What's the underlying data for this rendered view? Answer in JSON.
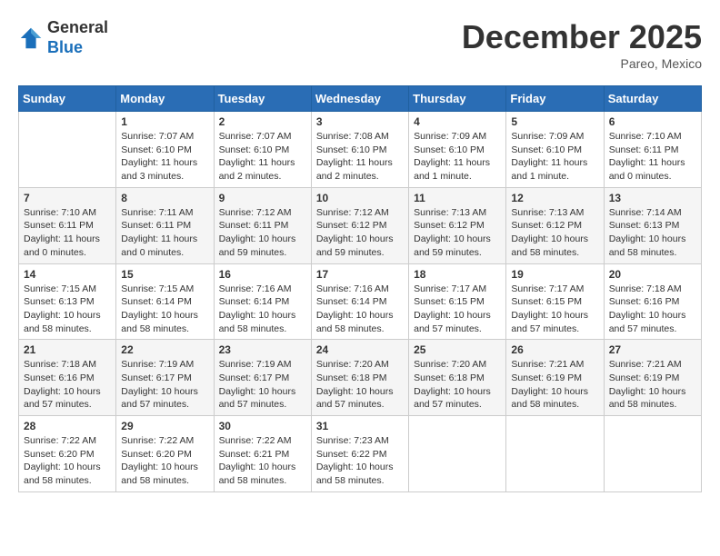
{
  "header": {
    "logo_general": "General",
    "logo_blue": "Blue",
    "month_title": "December 2025",
    "location": "Pareo, Mexico"
  },
  "days_of_week": [
    "Sunday",
    "Monday",
    "Tuesday",
    "Wednesday",
    "Thursday",
    "Friday",
    "Saturday"
  ],
  "weeks": [
    [
      {
        "day": "",
        "info": ""
      },
      {
        "day": "1",
        "info": "Sunrise: 7:07 AM\nSunset: 6:10 PM\nDaylight: 11 hours\nand 3 minutes."
      },
      {
        "day": "2",
        "info": "Sunrise: 7:07 AM\nSunset: 6:10 PM\nDaylight: 11 hours\nand 2 minutes."
      },
      {
        "day": "3",
        "info": "Sunrise: 7:08 AM\nSunset: 6:10 PM\nDaylight: 11 hours\nand 2 minutes."
      },
      {
        "day": "4",
        "info": "Sunrise: 7:09 AM\nSunset: 6:10 PM\nDaylight: 11 hours\nand 1 minute."
      },
      {
        "day": "5",
        "info": "Sunrise: 7:09 AM\nSunset: 6:10 PM\nDaylight: 11 hours\nand 1 minute."
      },
      {
        "day": "6",
        "info": "Sunrise: 7:10 AM\nSunset: 6:11 PM\nDaylight: 11 hours\nand 0 minutes."
      }
    ],
    [
      {
        "day": "7",
        "info": "Sunrise: 7:10 AM\nSunset: 6:11 PM\nDaylight: 11 hours\nand 0 minutes."
      },
      {
        "day": "8",
        "info": "Sunrise: 7:11 AM\nSunset: 6:11 PM\nDaylight: 11 hours\nand 0 minutes."
      },
      {
        "day": "9",
        "info": "Sunrise: 7:12 AM\nSunset: 6:11 PM\nDaylight: 10 hours\nand 59 minutes."
      },
      {
        "day": "10",
        "info": "Sunrise: 7:12 AM\nSunset: 6:12 PM\nDaylight: 10 hours\nand 59 minutes."
      },
      {
        "day": "11",
        "info": "Sunrise: 7:13 AM\nSunset: 6:12 PM\nDaylight: 10 hours\nand 59 minutes."
      },
      {
        "day": "12",
        "info": "Sunrise: 7:13 AM\nSunset: 6:12 PM\nDaylight: 10 hours\nand 58 minutes."
      },
      {
        "day": "13",
        "info": "Sunrise: 7:14 AM\nSunset: 6:13 PM\nDaylight: 10 hours\nand 58 minutes."
      }
    ],
    [
      {
        "day": "14",
        "info": "Sunrise: 7:15 AM\nSunset: 6:13 PM\nDaylight: 10 hours\nand 58 minutes."
      },
      {
        "day": "15",
        "info": "Sunrise: 7:15 AM\nSunset: 6:14 PM\nDaylight: 10 hours\nand 58 minutes."
      },
      {
        "day": "16",
        "info": "Sunrise: 7:16 AM\nSunset: 6:14 PM\nDaylight: 10 hours\nand 58 minutes."
      },
      {
        "day": "17",
        "info": "Sunrise: 7:16 AM\nSunset: 6:14 PM\nDaylight: 10 hours\nand 58 minutes."
      },
      {
        "day": "18",
        "info": "Sunrise: 7:17 AM\nSunset: 6:15 PM\nDaylight: 10 hours\nand 57 minutes."
      },
      {
        "day": "19",
        "info": "Sunrise: 7:17 AM\nSunset: 6:15 PM\nDaylight: 10 hours\nand 57 minutes."
      },
      {
        "day": "20",
        "info": "Sunrise: 7:18 AM\nSunset: 6:16 PM\nDaylight: 10 hours\nand 57 minutes."
      }
    ],
    [
      {
        "day": "21",
        "info": "Sunrise: 7:18 AM\nSunset: 6:16 PM\nDaylight: 10 hours\nand 57 minutes."
      },
      {
        "day": "22",
        "info": "Sunrise: 7:19 AM\nSunset: 6:17 PM\nDaylight: 10 hours\nand 57 minutes."
      },
      {
        "day": "23",
        "info": "Sunrise: 7:19 AM\nSunset: 6:17 PM\nDaylight: 10 hours\nand 57 minutes."
      },
      {
        "day": "24",
        "info": "Sunrise: 7:20 AM\nSunset: 6:18 PM\nDaylight: 10 hours\nand 57 minutes."
      },
      {
        "day": "25",
        "info": "Sunrise: 7:20 AM\nSunset: 6:18 PM\nDaylight: 10 hours\nand 57 minutes."
      },
      {
        "day": "26",
        "info": "Sunrise: 7:21 AM\nSunset: 6:19 PM\nDaylight: 10 hours\nand 58 minutes."
      },
      {
        "day": "27",
        "info": "Sunrise: 7:21 AM\nSunset: 6:19 PM\nDaylight: 10 hours\nand 58 minutes."
      }
    ],
    [
      {
        "day": "28",
        "info": "Sunrise: 7:22 AM\nSunset: 6:20 PM\nDaylight: 10 hours\nand 58 minutes."
      },
      {
        "day": "29",
        "info": "Sunrise: 7:22 AM\nSunset: 6:20 PM\nDaylight: 10 hours\nand 58 minutes."
      },
      {
        "day": "30",
        "info": "Sunrise: 7:22 AM\nSunset: 6:21 PM\nDaylight: 10 hours\nand 58 minutes."
      },
      {
        "day": "31",
        "info": "Sunrise: 7:23 AM\nSunset: 6:22 PM\nDaylight: 10 hours\nand 58 minutes."
      },
      {
        "day": "",
        "info": ""
      },
      {
        "day": "",
        "info": ""
      },
      {
        "day": "",
        "info": ""
      }
    ]
  ]
}
